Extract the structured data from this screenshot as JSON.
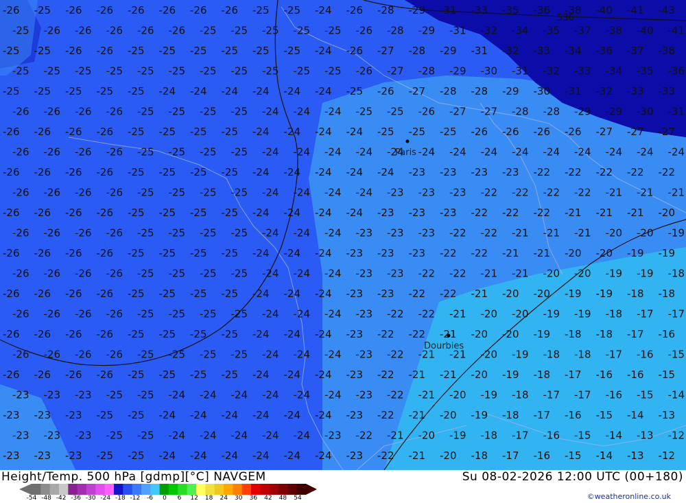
{
  "header": {
    "left_title": "Height/Temp. 500 hPa [gdmp][°C] NAVGEM",
    "right_title": "Su 08-02-2026 12:00 UTC (00+180)",
    "credit": "©weatheronline.co.uk"
  },
  "colorbar": {
    "ticks": [
      "-54",
      "-48",
      "-42",
      "-36",
      "-30",
      "-24",
      "-18",
      "-12",
      "-6",
      "0",
      "6",
      "12",
      "18",
      "24",
      "30",
      "36",
      "42",
      "48",
      "54"
    ],
    "colors": [
      "#6e6e6e",
      "#8c8c8c",
      "#a8a8a8",
      "#c8c8c8",
      "#8a2090",
      "#a030b0",
      "#c040d0",
      "#e050f0",
      "#ff60ff",
      "#1414c8",
      "#2850f0",
      "#3c78ff",
      "#50a0ff",
      "#40c8ff",
      "#00a000",
      "#00c800",
      "#28dc28",
      "#50f050",
      "#ffff60",
      "#f0e040",
      "#f0c820",
      "#ffa800",
      "#ff8000",
      "#ff4000",
      "#e00000",
      "#c00000",
      "#a00000",
      "#800000",
      "#600000",
      "#400000"
    ]
  },
  "map": {
    "places": [
      {
        "name": "Paris",
        "lon": 2.35,
        "lat": 48.86
      },
      {
        "name": "Dourbies",
        "lon": 3.45,
        "lat": 44.08
      }
    ],
    "contour_label": "536",
    "temperature_zones": [
      {
        "range": "<= -28",
        "color": "#0c0ca8"
      },
      {
        "range": "-28 to -26",
        "color": "#1e3cdc"
      },
      {
        "range": "-26 to -24",
        "color": "#2a5cf5"
      },
      {
        "range": "-24 to -22",
        "color": "#3a8cf5"
      },
      {
        "range": ">= -22",
        "color": "#33b4f2"
      }
    ]
  }
}
